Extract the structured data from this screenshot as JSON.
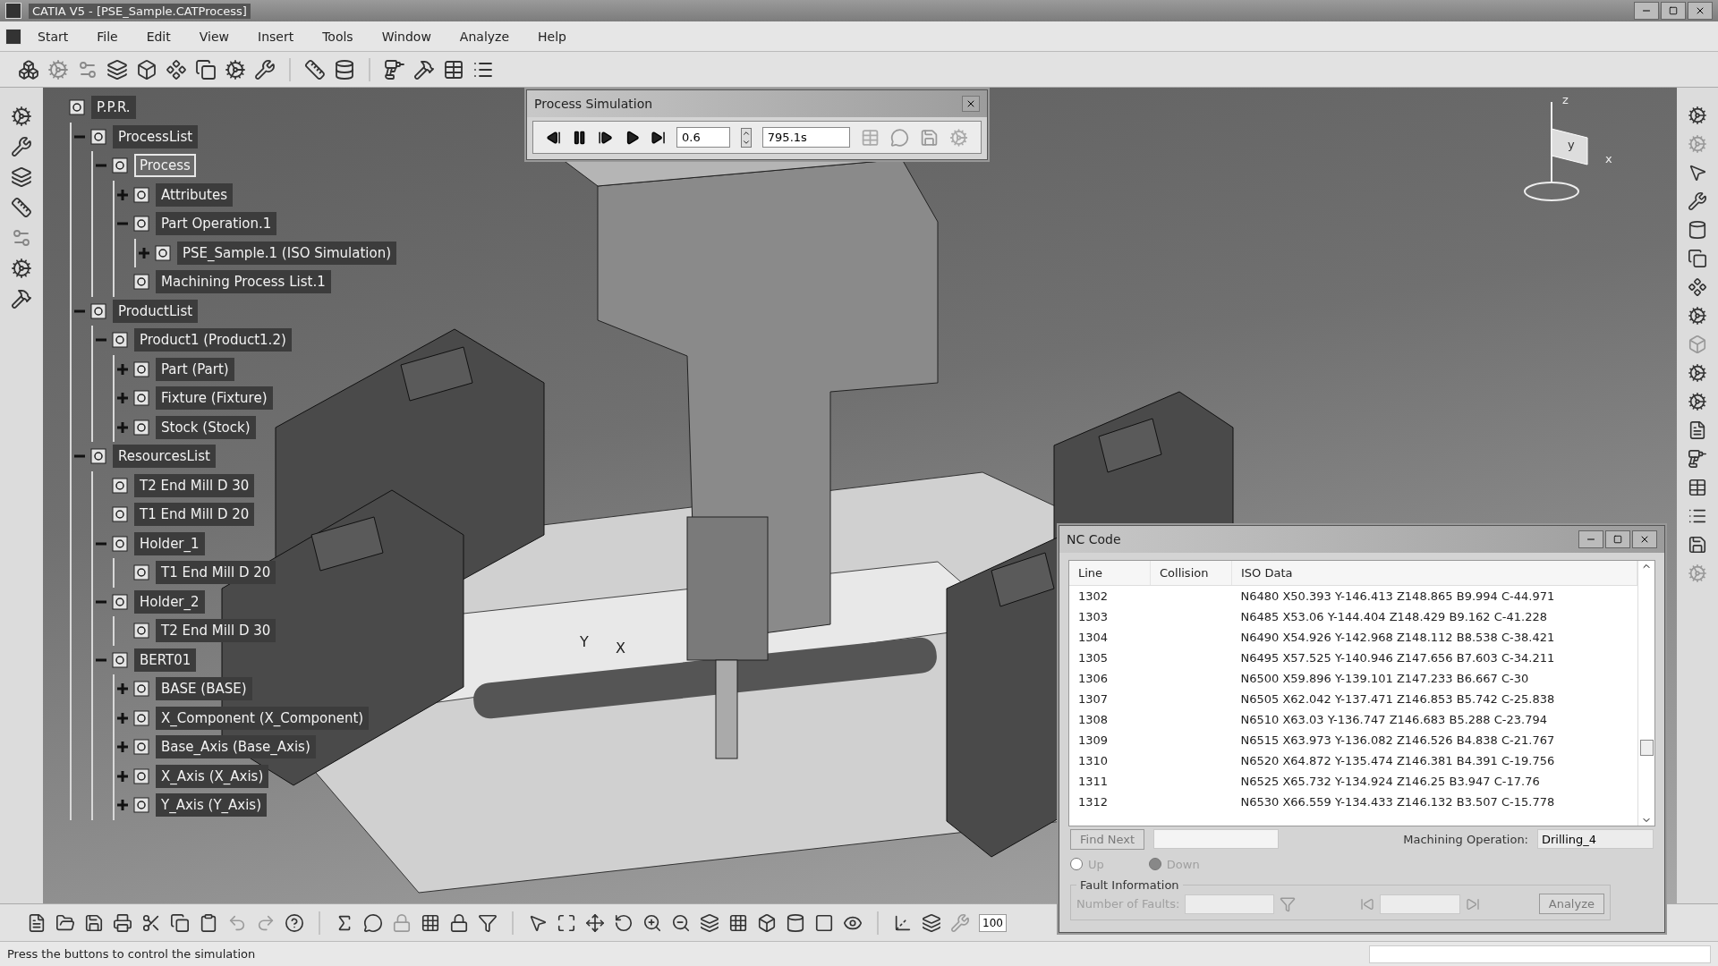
{
  "window": {
    "title": "CATIA V5 - [PSE_Sample.CATProcess]"
  },
  "menu": [
    "Start",
    "File",
    "Edit",
    "View",
    "Insert",
    "Tools",
    "Window",
    "Analyze",
    "Help"
  ],
  "tree": {
    "label": "P.P.R.",
    "selected": false,
    "children": [
      {
        "label": "ProcessList",
        "selected": false,
        "expanded": true,
        "children": [
          {
            "label": "Process",
            "selected": true,
            "expanded": true,
            "children": [
              {
                "label": "Attributes",
                "selected": false,
                "expanded": false
              },
              {
                "label": "Part Operation.1",
                "selected": false,
                "expanded": true,
                "children": [
                  {
                    "label": "PSE_Sample.1 (ISO Simulation)",
                    "selected": false,
                    "expanded": false
                  }
                ]
              },
              {
                "label": "Machining Process List.1",
                "selected": false
              }
            ]
          }
        ]
      },
      {
        "label": "ProductList",
        "selected": false,
        "expanded": true,
        "children": [
          {
            "label": "Product1 (Product1.2)",
            "selected": false,
            "expanded": true,
            "children": [
              {
                "label": "Part (Part)",
                "selected": false,
                "expanded": false
              },
              {
                "label": "Fixture (Fixture)",
                "selected": false,
                "expanded": false
              },
              {
                "label": "Stock (Stock)",
                "selected": false,
                "expanded": false
              }
            ]
          }
        ]
      },
      {
        "label": "ResourcesList",
        "selected": false,
        "expanded": true,
        "children": [
          {
            "label": "T2 End Mill D 30",
            "selected": false
          },
          {
            "label": "T1 End Mill D 20",
            "selected": false
          },
          {
            "label": "Holder_1",
            "selected": false,
            "expanded": true,
            "children": [
              {
                "label": "T1 End Mill D 20",
                "selected": false
              }
            ]
          },
          {
            "label": "Holder_2",
            "selected": false,
            "expanded": true,
            "children": [
              {
                "label": "T2 End Mill D 30",
                "selected": false
              }
            ]
          },
          {
            "label": "BERT01",
            "selected": false,
            "expanded": true,
            "children": [
              {
                "label": "BASE (BASE)",
                "selected": false,
                "expanded": false
              },
              {
                "label": "X_Component (X_Component)",
                "selected": false,
                "expanded": false
              },
              {
                "label": "Base_Axis (Base_Axis)",
                "selected": false,
                "expanded": false
              },
              {
                "label": "X_Axis (X_Axis)",
                "selected": false,
                "expanded": false
              },
              {
                "label": "Y_Axis (Y_Axis)",
                "selected": false,
                "expanded": false
              }
            ]
          }
        ]
      }
    ]
  },
  "process_simulation": {
    "title": "Process Simulation",
    "speed": "0.6",
    "time": "795.1s"
  },
  "compass": {
    "z": "z",
    "y": "y",
    "x": "x"
  },
  "tool_axis": {
    "y": "Y",
    "x": "X"
  },
  "nc_code": {
    "title": "NC Code",
    "columns": [
      "Line",
      "Collision",
      "ISO Data"
    ],
    "rows": [
      {
        "line": "1302",
        "iso_data": "N6480 X50.393 Y-146.413 Z148.865 B9.994 C-44.971"
      },
      {
        "line": "1303",
        "iso_data": "N6485 X53.06 Y-144.404 Z148.429 B9.162 C-41.228"
      },
      {
        "line": "1304",
        "iso_data": "N6490 X54.926 Y-142.968 Z148.112 B8.538 C-38.421"
      },
      {
        "line": "1305",
        "iso_data": "N6495 X57.525 Y-140.946 Z147.656 B7.603 C-34.211"
      },
      {
        "line": "1306",
        "iso_data": "N6500 X59.896 Y-139.101 Z147.233 B6.667 C-30"
      },
      {
        "line": "1307",
        "iso_data": "N6505 X62.042 Y-137.471 Z146.853 B5.742 C-25.838"
      },
      {
        "line": "1308",
        "iso_data": "N6510 X63.03 Y-136.747 Z146.683 B5.288 C-23.794"
      },
      {
        "line": "1309",
        "iso_data": "N6515 X63.973 Y-136.082 Z146.526 B4.838 C-21.767"
      },
      {
        "line": "1310",
        "iso_data": "N6520 X64.872 Y-135.474 Z146.381 B4.391 C-19.756"
      },
      {
        "line": "1311",
        "iso_data": "N6525 X65.732 Y-134.924 Z146.25 B3.947 C-17.76"
      },
      {
        "line": "1312",
        "iso_data": "N6530 X66.559 Y-134.433 Z146.132 B3.507 C-15.778"
      }
    ],
    "find_next": {
      "label": "Find Next",
      "disabled": true
    },
    "direction": [
      {
        "label": "Up",
        "selected": false,
        "disabled": true
      },
      {
        "label": "Down",
        "selected": true,
        "disabled": true
      }
    ],
    "machining_operation": {
      "label": "Machining Operation:",
      "value": "Drilling_4"
    },
    "fault_information": {
      "title": "Fault Information",
      "faults_label": "Number of Faults:",
      "analyze": {
        "label": "Analyze",
        "disabled": true
      }
    }
  },
  "zoom_field": "100",
  "status_bar": "Press the buttons to control the simulation"
}
